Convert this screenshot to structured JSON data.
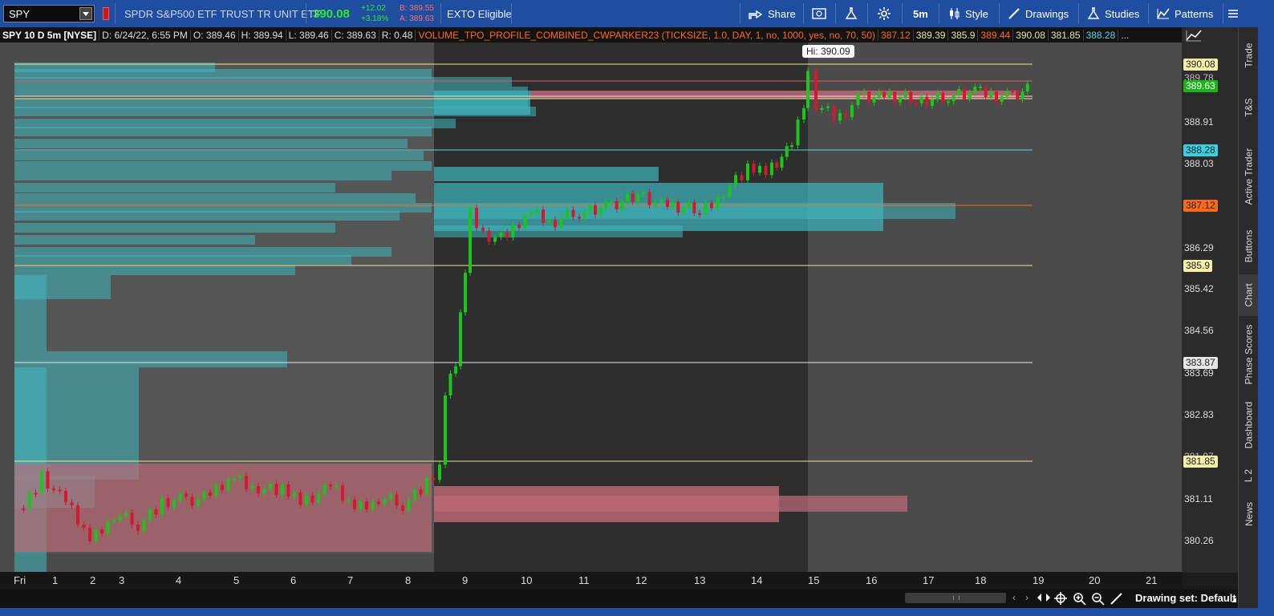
{
  "toolbar": {
    "symbol": "SPY",
    "description": "SPDR S&P500 ETF TRUST TR UNIT ETF",
    "last": "390.08",
    "change": "+12.02",
    "change_pct": "+3.18%",
    "bid": "B: 389.55",
    "ask": "A: 389.63",
    "exto": "EXTO Eligible",
    "share": "Share",
    "timeframe": "5m",
    "style": "Style",
    "drawings": "Drawings",
    "studies": "Studies",
    "patterns": "Patterns"
  },
  "infobar": {
    "title": "SPY 10 D 5m [NYSE]",
    "date": "D: 6/24/22, 6:55 PM",
    "open": "O: 389.46",
    "high": "H: 389.94",
    "low": "L: 389.46",
    "close": "C: 389.63",
    "range": "R: 0.48",
    "study": "VOLUME_TPO_PROFILE_COMBINED_CWPARKER23 (TICKSIZE, 1.0, DAY, 1, no, 1000, yes, no, 70, 50)",
    "study_values": [
      "387.12",
      "389.39",
      "385.9",
      "389.44",
      "390.08",
      "381.85",
      "388.28"
    ],
    "more": "..."
  },
  "chart": {
    "hi_label": "Hi: 390.09",
    "levels": {
      "high": 390.08,
      "last": 389.63,
      "vwap": 388.28,
      "poc": 387.12,
      "vah": 385.9,
      "mid": 383.87,
      "val": 381.85
    },
    "colors": {
      "up": "#19c619",
      "down": "#d2192d",
      "profile_teal": "#3fb7be",
      "profile_red": "#c26a77",
      "level_yellow": "#f0e68c",
      "level_cyan": "#5ad4e0",
      "level_orange": "#ff6a1a"
    }
  },
  "price_axis": [
    "388.91",
    "388.03",
    "386.29",
    "385.42",
    "384.56",
    "383.69",
    "382.83",
    "381.11",
    "380.26"
  ],
  "price_badges": {
    "high": "390.08",
    "hidden": "389.78",
    "last": "389.63",
    "vwap": "388.28",
    "poc": "387.12",
    "vah": "385.9",
    "mid": "383.87",
    "hidden2": "381.97",
    "val": "381.85"
  },
  "time_axis": [
    "Fri",
    "1",
    "2",
    "3",
    "4",
    "5",
    "6",
    "7",
    "8",
    "9",
    "10",
    "11",
    "12",
    "13",
    "14",
    "15",
    "16",
    "17",
    "18",
    "19",
    "20",
    "21"
  ],
  "sidebar_tabs": [
    "Trade",
    "T&S",
    "Active Trader",
    "Buttons",
    "Chart",
    "Phase Scores",
    "Dashboard",
    "L 2",
    "News"
  ],
  "bottom": {
    "drawing_set": "Drawing set: Default"
  }
}
